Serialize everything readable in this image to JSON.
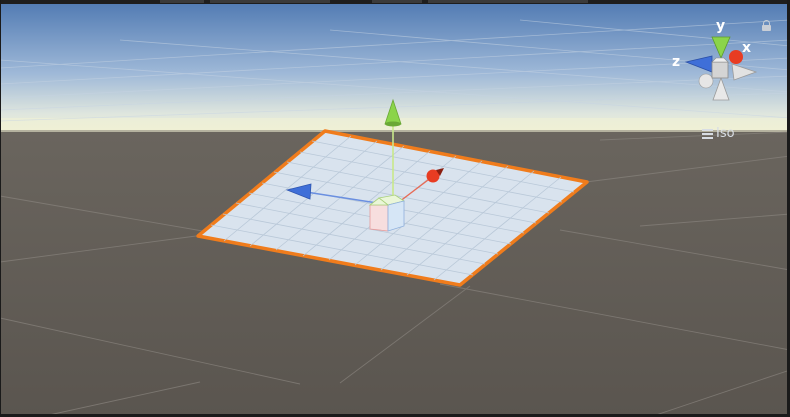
{
  "viewport": {
    "name": "scene-view",
    "colors": {
      "sky_top": "#5a82b8",
      "sky_horizon": "#e6ecd8",
      "ground": "#5d5852",
      "grid_line": "#8a8580",
      "plane_fill": "#d9e3ee",
      "selection_outline": "#f07c1c",
      "x_axis": "#e83c22",
      "y_axis": "#8bd44a",
      "z_axis": "#3f6fd8",
      "center_cube": "#d9e8f2"
    }
  },
  "orientation_gizmo": {
    "labels": {
      "x": "x",
      "y": "y",
      "z": "z"
    },
    "projection_label": "Iso",
    "projection_icon": "hamburger-icon",
    "lock_icon": "lock-icon"
  },
  "selected_object": {
    "type": "plane",
    "move_tool_active": true
  }
}
